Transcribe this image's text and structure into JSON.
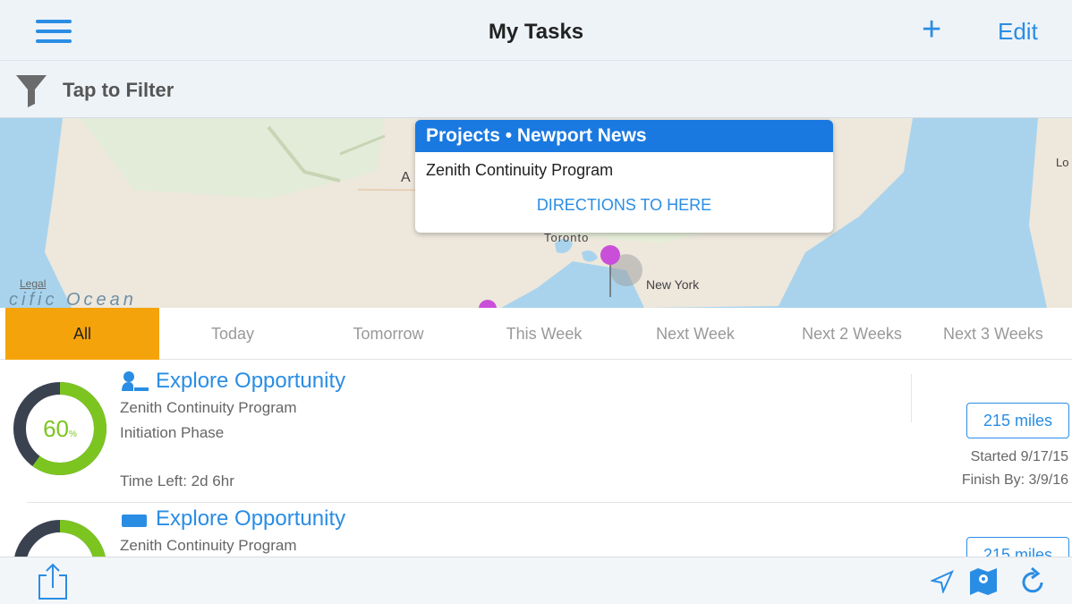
{
  "navbar": {
    "title": "My Tasks",
    "plus": "+",
    "edit": "Edit"
  },
  "filter": {
    "label": "Tap to Filter"
  },
  "map": {
    "callout_title": "Projects • Newport News",
    "callout_subtitle": "Zenith Continuity Program",
    "callout_action": "DIRECTIONS TO HERE",
    "legal": "Legal",
    "ocean_label": "cific Ocean",
    "label_toronto": "Toronto",
    "label_newyork": "New York",
    "label_a": "A",
    "label_lo": "Lo"
  },
  "tabs": [
    "All",
    "Today",
    "Tomorrow",
    "This Week",
    "Next Week",
    "Next 2 Weeks",
    "Next 3 Weeks"
  ],
  "tasks": [
    {
      "progress_pct": 60,
      "progress_text": "60",
      "progress_unit": "%",
      "title": "Explore Opportunity",
      "program": "Zenith Continuity Program",
      "phase": "Initiation Phase",
      "time_left": "Time Left: 2d 6hr",
      "distance": "215 miles",
      "started": "Started 9/17/15",
      "finish": "Finish By: 3/9/16",
      "icon": "person-icon"
    },
    {
      "progress_pct": 60,
      "title": "Explore Opportunity",
      "program": "Zenith Continuity Program",
      "distance": "215 miles",
      "icon": "tag-icon"
    }
  ],
  "colors": {
    "accent": "#2a8de4",
    "active_tab": "#f5a30b",
    "ring_fill": "#7cc520",
    "ring_track": "#3a4250",
    "callout_head": "#1a79e0"
  }
}
